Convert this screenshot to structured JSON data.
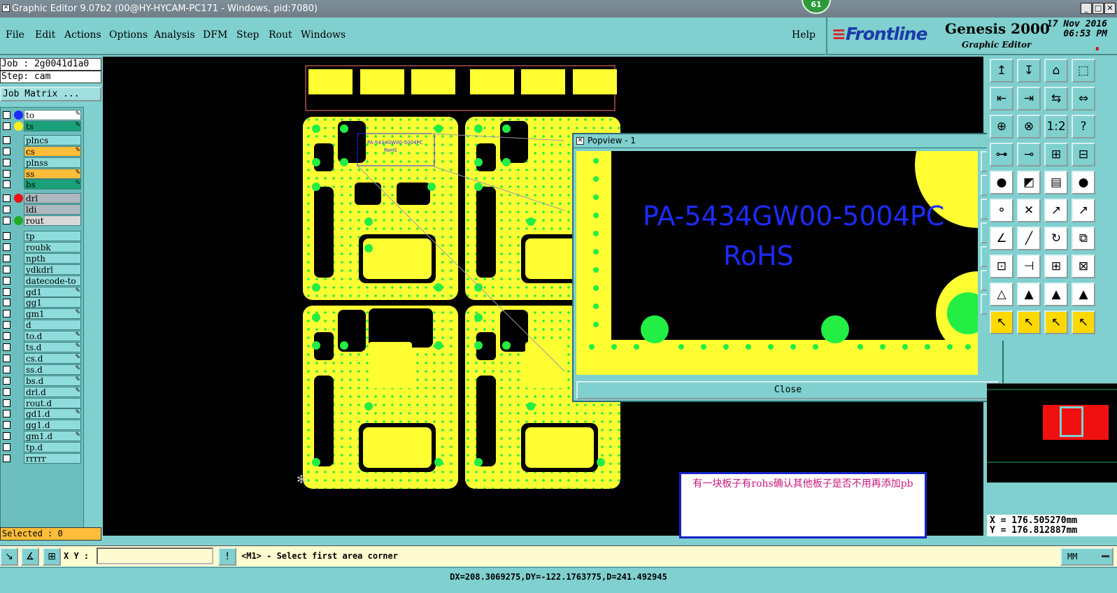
{
  "window": {
    "title": "Graphic Editor 9.07b2 (00@HY-HYCAM-PC171 - Windows, pid:7080)",
    "badge": "61",
    "app_icon": "x-icon"
  },
  "menu": {
    "items": [
      "File",
      "Edit",
      "Actions",
      "Options",
      "Analysis",
      "DFM",
      "Step",
      "Rout",
      "Windows"
    ],
    "help": "Help"
  },
  "brand": {
    "logo": "Frontline",
    "product": "Genesis 2000",
    "subtitle": "Graphic Editor",
    "date": "17 Nov 2016",
    "time": "06:53 PM",
    "pause": "⏸"
  },
  "job": {
    "job_label": "Job : 2g0041d1a0",
    "step_label": "Step: cam",
    "matrix_button": "Job Matrix ..."
  },
  "layers": [
    {
      "name": "to",
      "dot": "#1d2bff",
      "style": "sel",
      "pen": true
    },
    {
      "name": "ts",
      "dot": "#ffee22",
      "style": "grn",
      "pen": true
    },
    {
      "name": "plncs",
      "dot": "",
      "style": "",
      "pen": false
    },
    {
      "name": "cs",
      "dot": "",
      "style": "org",
      "pen": true
    },
    {
      "name": "plnss",
      "dot": "",
      "style": "",
      "pen": false
    },
    {
      "name": "ss",
      "dot": "",
      "style": "org",
      "pen": true
    },
    {
      "name": "bs",
      "dot": "",
      "style": "grn",
      "pen": true
    },
    {
      "name": "drl",
      "dot": "#ee1111",
      "style": "gry",
      "pen": false
    },
    {
      "name": "ldi",
      "dot": "",
      "style": "gry",
      "pen": false
    },
    {
      "name": "rout",
      "dot": "#22aa22",
      "style": "bl",
      "pen": false
    },
    {
      "name": "tp",
      "dot": "",
      "style": "",
      "pen": false
    },
    {
      "name": "roubk",
      "dot": "",
      "style": "",
      "pen": false
    },
    {
      "name": "npth",
      "dot": "",
      "style": "",
      "pen": false
    },
    {
      "name": "ydkdrl",
      "dot": "",
      "style": "",
      "pen": false
    },
    {
      "name": "datecode-to",
      "dot": "",
      "style": "",
      "pen": false
    },
    {
      "name": "gd1",
      "dot": "",
      "style": "",
      "pen": true
    },
    {
      "name": "gg1",
      "dot": "",
      "style": "",
      "pen": false
    },
    {
      "name": "gm1",
      "dot": "",
      "style": "",
      "pen": true
    },
    {
      "name": "d",
      "dot": "",
      "style": "",
      "pen": false
    },
    {
      "name": "to.d",
      "dot": "",
      "style": "",
      "pen": true
    },
    {
      "name": "ts.d",
      "dot": "",
      "style": "",
      "pen": true
    },
    {
      "name": "cs.d",
      "dot": "",
      "style": "",
      "pen": true
    },
    {
      "name": "ss.d",
      "dot": "",
      "style": "",
      "pen": true
    },
    {
      "name": "bs.d",
      "dot": "",
      "style": "",
      "pen": true
    },
    {
      "name": "drl.d",
      "dot": "",
      "style": "",
      "pen": true
    },
    {
      "name": "rout.d",
      "dot": "",
      "style": "",
      "pen": false
    },
    {
      "name": "gd1.d",
      "dot": "",
      "style": "",
      "pen": true
    },
    {
      "name": "gg1.d",
      "dot": "",
      "style": "",
      "pen": false
    },
    {
      "name": "gm1.d",
      "dot": "",
      "style": "",
      "pen": true
    },
    {
      "name": "tp.d",
      "dot": "",
      "style": "",
      "pen": false
    },
    {
      "name": "rrrrr",
      "dot": "",
      "style": "",
      "pen": false
    }
  ],
  "selected": "Selected : 0",
  "popview": {
    "title": "Popview - 1",
    "part_number": "PA-5434GW00-5004PC",
    "rohs": "RoHS",
    "close_label": "Close"
  },
  "board_labels": {
    "small_pn": "PA-5434GW00-5004PC",
    "small_rohs": "RoHS"
  },
  "note": "有一块板子有rohs确认其他板子是否不用再添加pb",
  "coords": {
    "x": "X = 176.505270mm",
    "y": "Y = 176.812887mm"
  },
  "bottom": {
    "xy_label": "X Y :",
    "xy_value": "",
    "prompt": "<M1> - Select first area corner",
    "units": "MM"
  },
  "status": "DX=208.3069275,DY=-122.1763775,D=241.492945",
  "toolbox": [
    "↥",
    "↧",
    "⌂",
    "⬚",
    "⇤",
    "⇥",
    "⇆",
    "⇔",
    "⊕",
    "⊗",
    "1:2",
    "?",
    "⊶",
    "⊸",
    "⊞",
    "⊟",
    "●",
    "◩",
    "▤",
    "●",
    "⚬",
    "✕",
    "↗",
    "↗",
    "∠",
    "╱",
    "↻",
    "⧉",
    "⊡",
    "⊣",
    "⊞",
    "⊠",
    "△",
    "▲",
    "▲",
    "▲",
    "↖",
    "↖",
    "↖",
    "↖"
  ],
  "colors": {
    "board": "#ffff33",
    "pad": "#22ee44",
    "text": "#1d2bff",
    "canvas": "#000000"
  }
}
